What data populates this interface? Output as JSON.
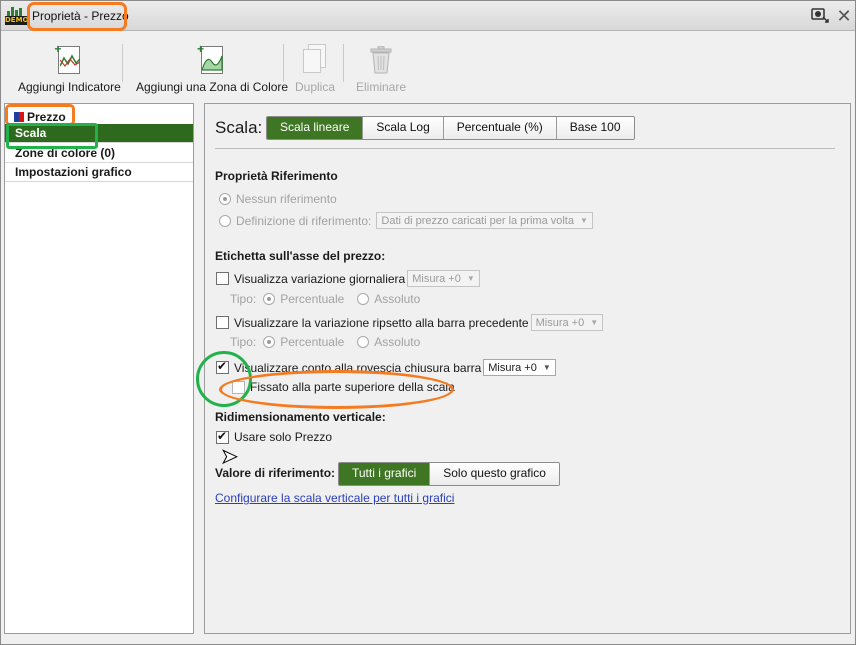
{
  "window": {
    "title": "Proprietà - Prezzo",
    "app_badge": "DEMO"
  },
  "titlebar": {
    "pin_icon": "pin-icon",
    "close_icon": "close-icon"
  },
  "toolbar": {
    "add_indicator": "Aggiungi Indicatore",
    "add_color_zone": "Aggiungi una Zona di Colore",
    "duplicate": "Duplica",
    "delete": "Eliminare"
  },
  "tree": {
    "root": "Prezzo",
    "items": [
      {
        "label": "Scala",
        "selected": true
      },
      {
        "label": "Zone di colore (0)",
        "selected": false
      },
      {
        "label": "Impostazioni grafico",
        "selected": false
      }
    ]
  },
  "panel": {
    "scale_title": "Scala:",
    "scale_options": [
      "Scala lineare",
      "Scala Log",
      "Percentuale (%)",
      "Base 100"
    ],
    "scale_selected": "Scala lineare",
    "ref_props": {
      "heading": "Proprietà Riferimento",
      "no_ref": "Nessun riferimento",
      "def_ref": "Definizione di riferimento:",
      "def_ref_value": "Dati di prezzo caricati per la prima volta"
    },
    "axis_label": {
      "heading": "Etichetta sull'asse del prezzo:",
      "daily_change": "Visualizza variazione giornaliera",
      "daily_change_value": "Misura +0",
      "type_label": "Tipo:",
      "type_percent": "Percentuale",
      "type_absolute": "Assoluto",
      "prev_bar_change": "Visualizzare la variazione ripsetto alla barra precedente",
      "prev_bar_value": "Misura +0",
      "type_label_2": "Tipo:",
      "type_percent_2": "Percentuale",
      "type_absolute_2": "Assoluto",
      "countdown": "Visualizzare conto alla rovescia chiusura barra",
      "countdown_value": "Misura +0",
      "fixed_top": "Fissato alla parte superiore della scala"
    },
    "vertical_resize": {
      "heading": "Ridimensionamento verticale:",
      "price_only": "Usare solo Prezzo"
    },
    "ref_value": {
      "label": "Valore di riferimento:",
      "options": [
        "Tutti i grafici",
        "Solo questo grafico"
      ],
      "selected": "Tutti i grafici"
    },
    "link": "Configurare la scala verticale per tutti i grafici"
  },
  "colors": {
    "accent_green": "#3f7624",
    "annotation_orange": "#f47b20",
    "annotation_green": "#22b24c",
    "link_blue": "#2a3fb8"
  }
}
